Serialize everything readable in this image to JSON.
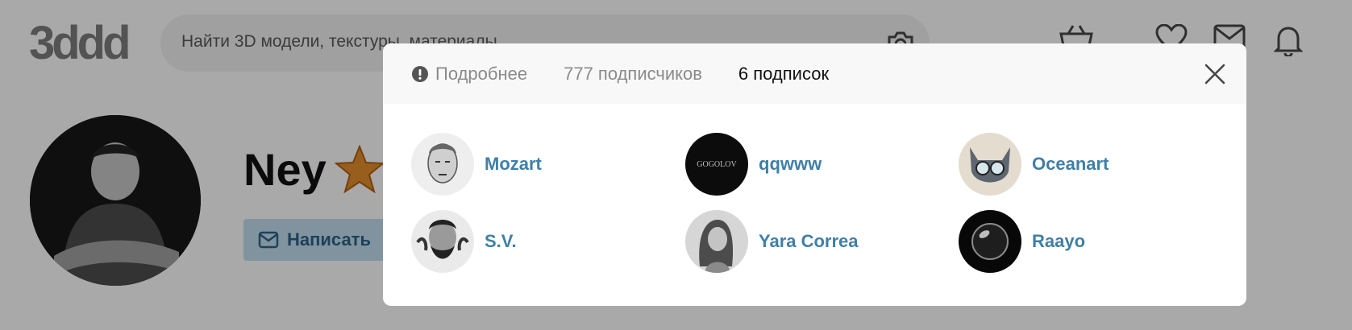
{
  "header": {
    "logo_text": "3ddd",
    "search_placeholder": "Найти 3D модели, текстуры, материалы",
    "icons": [
      "camera-icon",
      "basket-icon",
      "heart-icon",
      "mail-icon",
      "bell-icon"
    ]
  },
  "profile": {
    "name": "Ney",
    "write_label": "Написать"
  },
  "modal": {
    "tabs": {
      "details": "Подробнее",
      "followers": "777 подписчиков",
      "following": "6 подписок"
    },
    "active_tab": "following",
    "users": [
      {
        "name": "Mozart"
      },
      {
        "name": "qqwww",
        "avatar_text": "GOGOLOV"
      },
      {
        "name": "Oceanart"
      },
      {
        "name": "S.V."
      },
      {
        "name": "Yara Correa"
      },
      {
        "name": "Raayo"
      }
    ]
  },
  "colors": {
    "link": "#3f7fa8",
    "overlay": "rgba(0,0,0,0.30)",
    "button_bg": "#b8d3e4",
    "star": "#d9872a"
  }
}
